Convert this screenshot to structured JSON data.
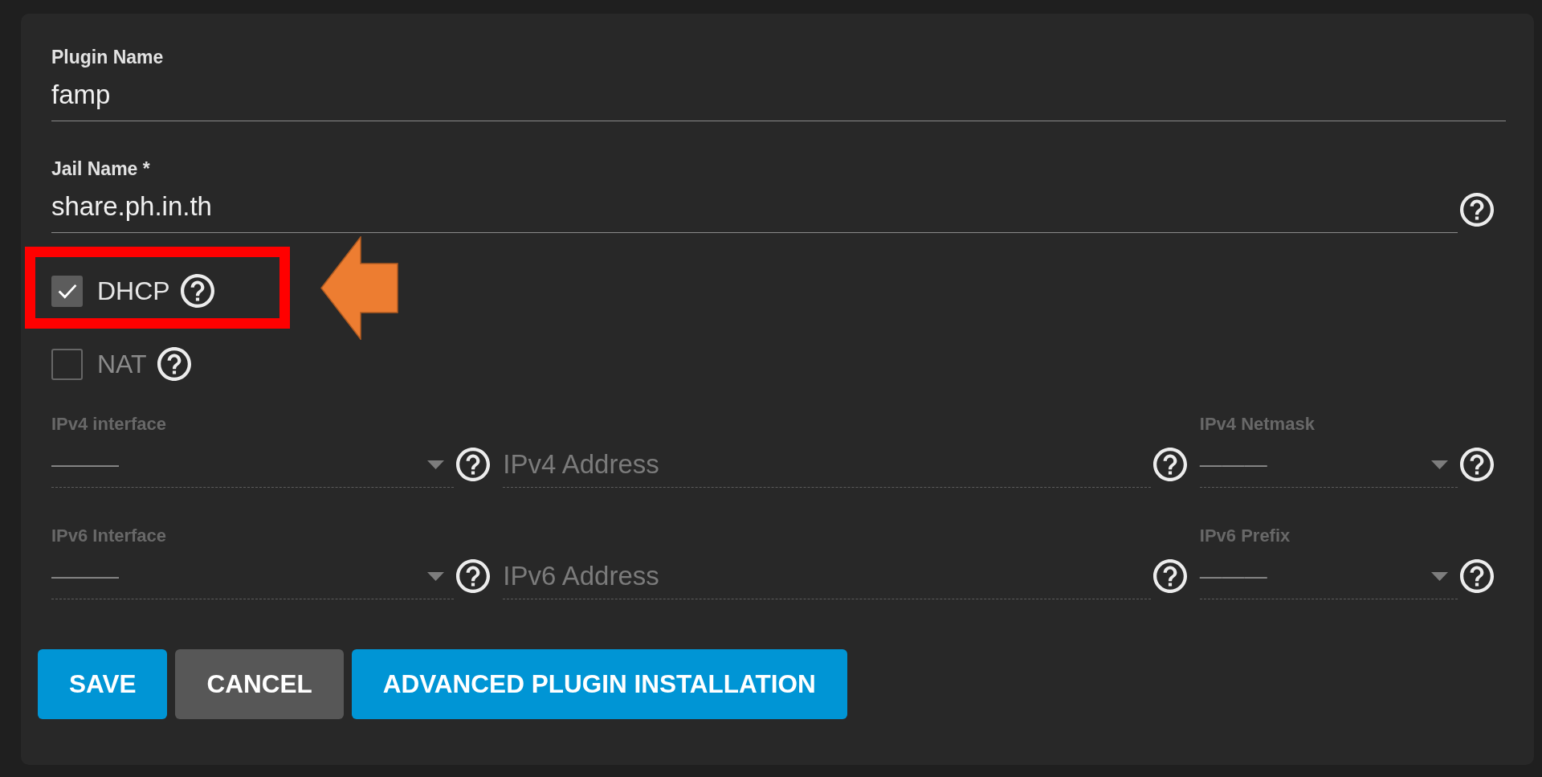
{
  "fields": [
    {
      "label": "Plugin Name",
      "value": "famp",
      "help": false
    },
    {
      "label": "Jail Name *",
      "value": "share.ph.in.th",
      "help": true
    }
  ],
  "checkboxes": [
    {
      "label": "DHCP",
      "checked": true,
      "disabled": false,
      "help": true,
      "highlight_frame": true,
      "pointer_arrow": true
    },
    {
      "label": "NAT",
      "checked": false,
      "disabled": true,
      "help": true,
      "highlight_frame": false,
      "pointer_arrow": false
    }
  ],
  "network_rows": [
    {
      "fields": [
        {
          "kind": "select",
          "label": "IPv4 interface",
          "value": "———",
          "disabled": true,
          "help": true
        },
        {
          "kind": "input",
          "placeholder": "IPv4 Address",
          "disabled": true,
          "help": true
        },
        {
          "kind": "select",
          "label": "IPv4 Netmask",
          "value": "———",
          "disabled": true,
          "help": true
        }
      ]
    },
    {
      "fields": [
        {
          "kind": "select",
          "label": "IPv6 Interface",
          "value": "———",
          "disabled": true,
          "help": true
        },
        {
          "kind": "input",
          "placeholder": "IPv6 Address",
          "disabled": true,
          "help": true
        },
        {
          "kind": "select",
          "label": "IPv6 Prefix",
          "value": "———",
          "disabled": true,
          "help": true
        }
      ]
    }
  ],
  "buttons": [
    {
      "label": "SAVE",
      "kind": "primary"
    },
    {
      "label": "CANCEL",
      "kind": "secondary"
    },
    {
      "label": "ADVANCED PLUGIN INSTALLATION",
      "kind": "primary"
    }
  ]
}
